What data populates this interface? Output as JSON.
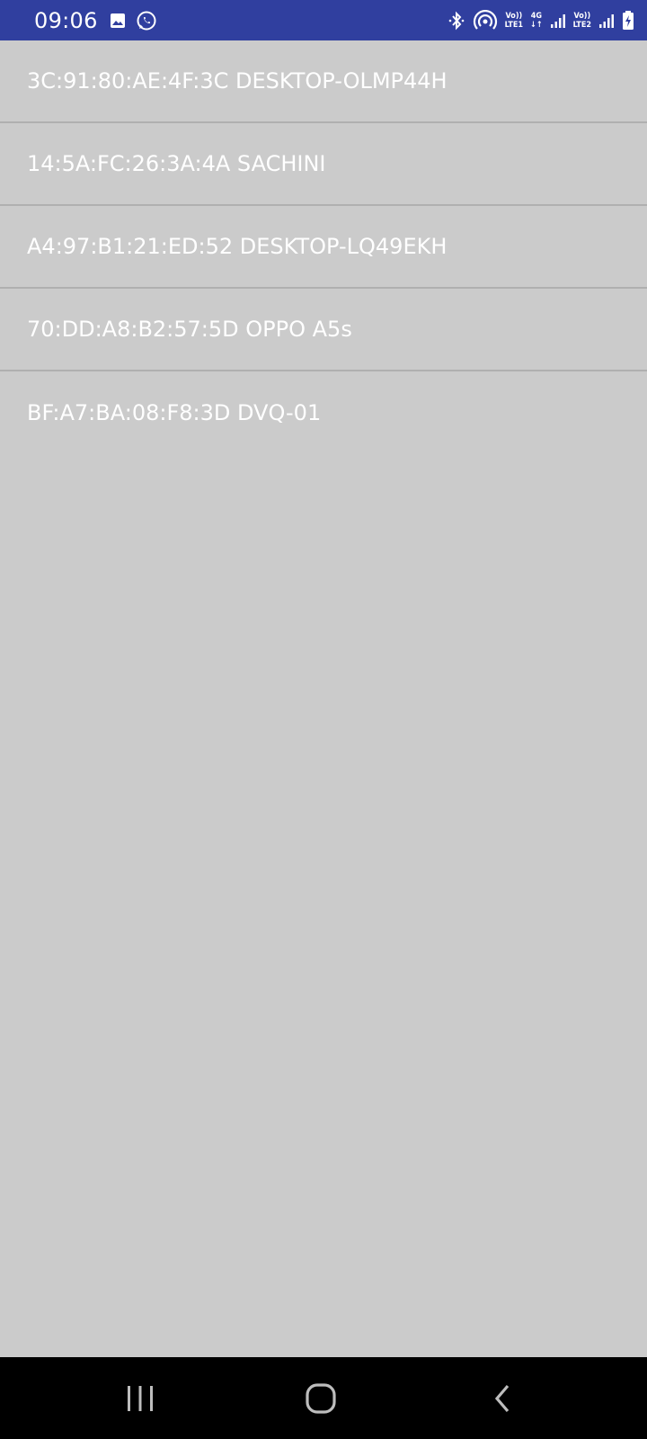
{
  "status_bar": {
    "time": "09:06",
    "icons_left": [
      "gallery-icon",
      "whatsapp-icon"
    ],
    "bluetooth": "bluetooth-icon",
    "hotspot": "hotspot-icon",
    "sim1": {
      "top": "Vo))",
      "bottom": "LTE1"
    },
    "network_type": {
      "top": "4G",
      "bottom": "↓↑"
    },
    "sim2": {
      "top": "Vo))",
      "bottom": "LTE2"
    },
    "battery": "battery-charging-icon"
  },
  "devices": [
    {
      "label": "3C:91:80:AE:4F:3C DESKTOP-OLMP44H"
    },
    {
      "label": "14:5A:FC:26:3A:4A SACHINI"
    },
    {
      "label": "A4:97:B1:21:ED:52 DESKTOP-LQ49EKH"
    },
    {
      "label": "70:DD:A8:B2:57:5D OPPO A5s"
    },
    {
      "label": "BF:A7:BA:08:F8:3D DVQ-01"
    }
  ],
  "nav_bar": {
    "recents": "recents-icon",
    "home": "home-icon",
    "back": "back-icon"
  },
  "colors": {
    "status_bar": "#303f9f",
    "background": "#cbcbcb",
    "divider": "#b0b0b0",
    "text": "#ffffff",
    "nav_bar": "#000000"
  }
}
